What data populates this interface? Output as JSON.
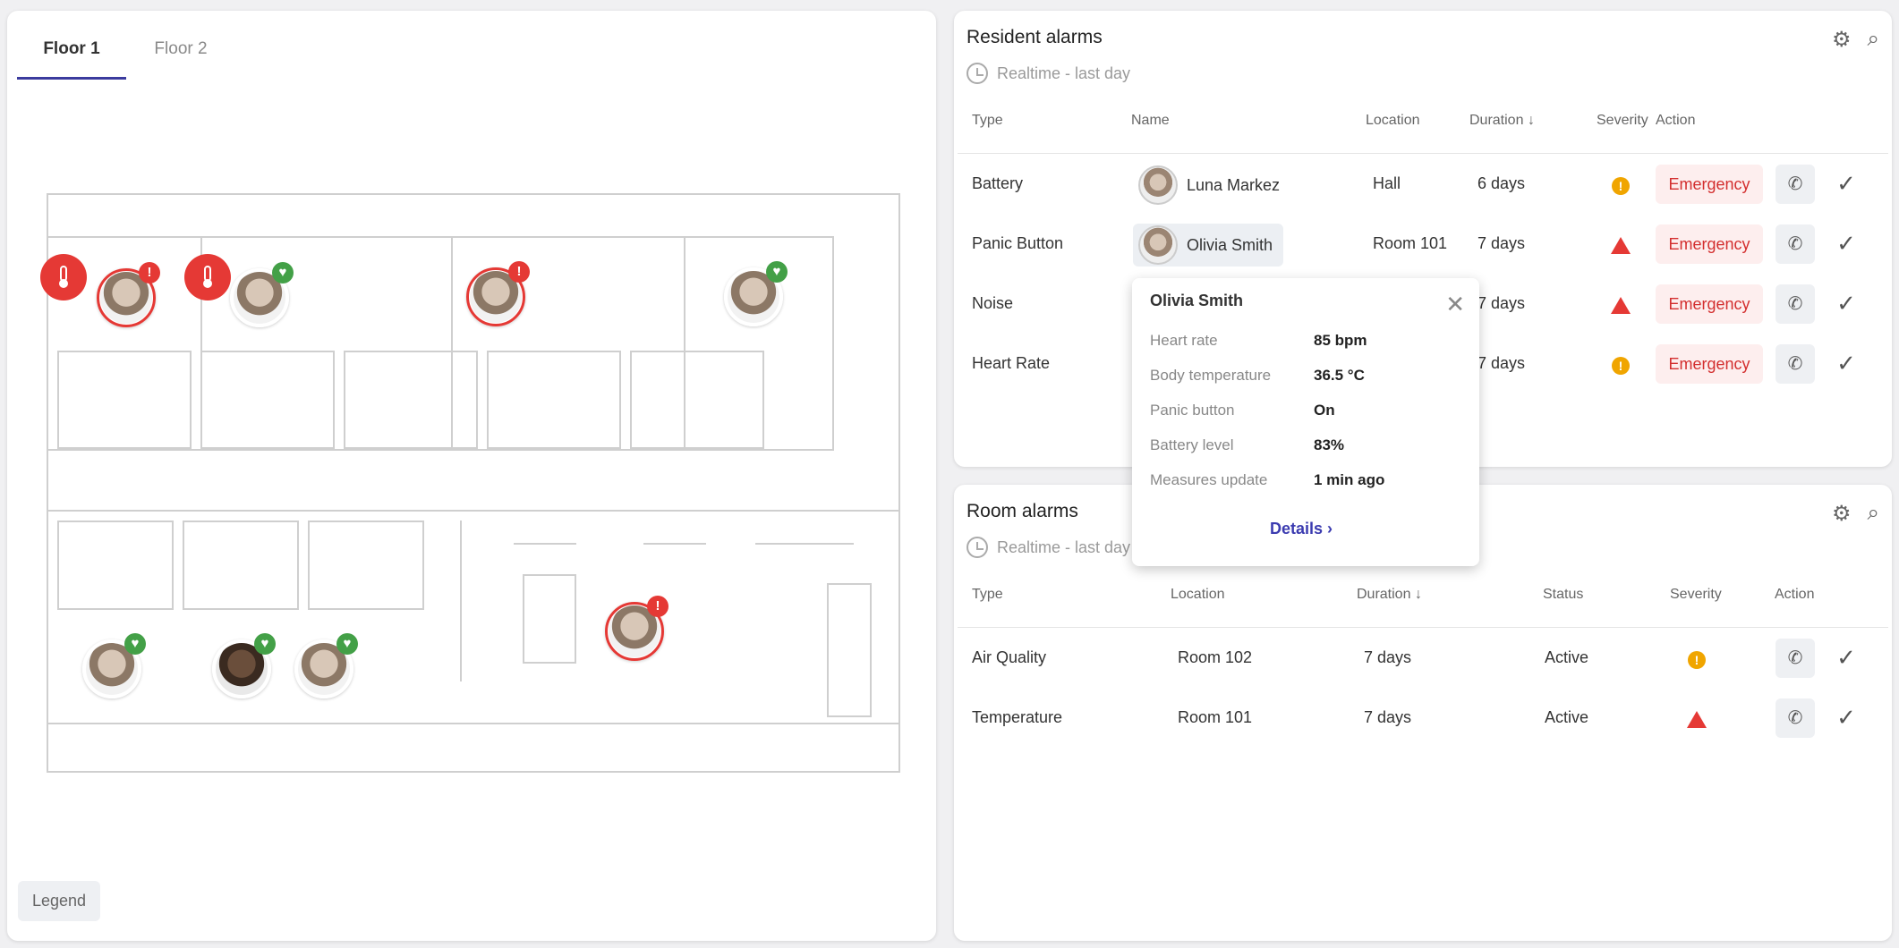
{
  "floor_tabs": [
    "Floor 1",
    "Floor 2"
  ],
  "legend_label": "Legend",
  "resident_alarms": {
    "title": "Resident alarms",
    "subtitle": "Realtime - last day",
    "headers": {
      "type": "Type",
      "name": "Name",
      "location": "Location",
      "duration": "Duration",
      "severity": "Severity",
      "action": "Action"
    },
    "rows": [
      {
        "type": "Battery",
        "name": "Luna Markez",
        "location": "Hall",
        "duration": "6 days",
        "severity": "warning",
        "action": "Emergency"
      },
      {
        "type": "Panic Button",
        "name": "Olivia Smith",
        "location": "Room 101",
        "duration": "7 days",
        "severity": "critical",
        "action": "Emergency"
      },
      {
        "type": "Noise",
        "name": "",
        "location": "",
        "duration": "7 days",
        "severity": "critical",
        "action": "Emergency"
      },
      {
        "type": "Heart Rate",
        "name": "",
        "location": "",
        "duration": "7 days",
        "severity": "warning",
        "action": "Emergency"
      }
    ]
  },
  "room_alarms": {
    "title": "Room alarms",
    "subtitle": "Realtime - last day",
    "headers": {
      "type": "Type",
      "location": "Location",
      "duration": "Duration",
      "status": "Status",
      "severity": "Severity",
      "action": "Action"
    },
    "rows": [
      {
        "type": "Air Quality",
        "location": "Room 102",
        "duration": "7 days",
        "status": "Active",
        "severity": "warning"
      },
      {
        "type": "Temperature",
        "location": "Room 101",
        "duration": "7 days",
        "status": "Active",
        "severity": "critical"
      }
    ]
  },
  "popup": {
    "name": "Olivia Smith",
    "rows": [
      {
        "label": "Heart rate",
        "value": "85 bpm"
      },
      {
        "label": "Body temperature",
        "value": "36.5 °C"
      },
      {
        "label": "Panic button",
        "value": "On"
      },
      {
        "label": "Battery level",
        "value": "83%"
      },
      {
        "label": "Measures update",
        "value": "1 min ago"
      }
    ],
    "details_label": "Details"
  },
  "colors": {
    "accent": "#3b3b9e",
    "alert": "#e53935",
    "ok": "#43a047",
    "warning": "#f0a500"
  }
}
